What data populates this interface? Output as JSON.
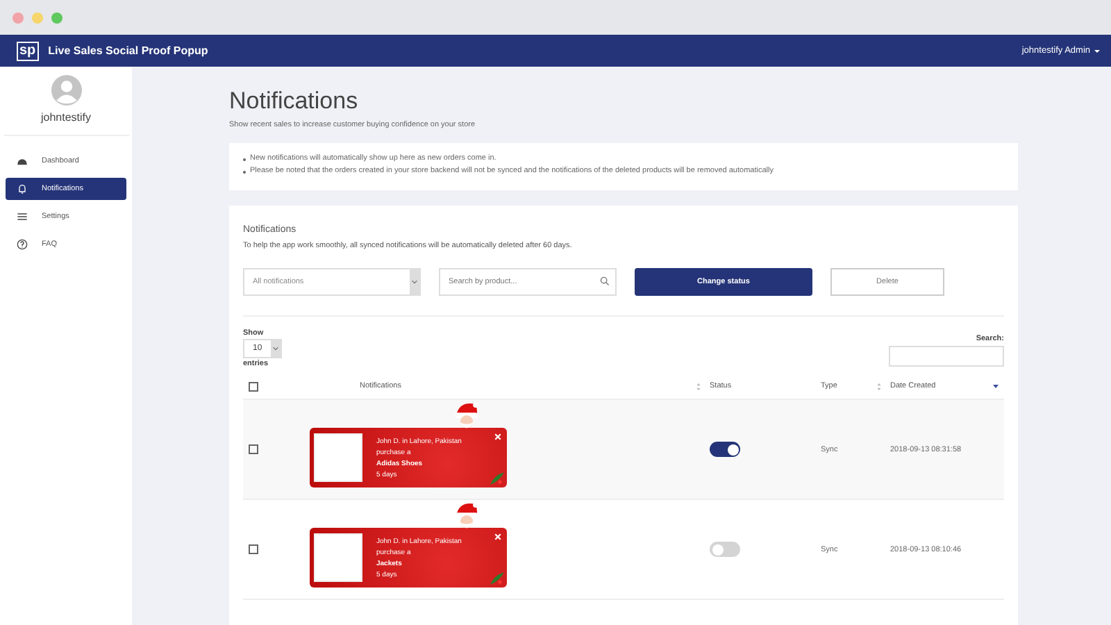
{
  "header": {
    "logo": "sp",
    "title": "Live Sales Social Proof Popup",
    "user_menu": "johntestify Admin"
  },
  "sidebar": {
    "username": "johntestify",
    "items": [
      {
        "label": "Dashboard",
        "selected": false
      },
      {
        "label": "Notifications",
        "selected": true
      },
      {
        "label": "Settings",
        "selected": false
      },
      {
        "label": "FAQ",
        "selected": false
      }
    ]
  },
  "page": {
    "title": "Notifications",
    "subtitle": "Show recent sales to increase customer buying confidence on your store",
    "notes": [
      "New notifications will automatically show up here as new orders come in.",
      "Please be noted that the orders created in your store backend will not be synced and the notifications of the deleted products will be removed automatically"
    ]
  },
  "card": {
    "title": "Notifications",
    "description": "To help the app work smoothly, all synced notifications will be automatically deleted after 60 days.",
    "filter": {
      "value": "All notifications"
    },
    "search": {
      "placeholder": "Search by product..."
    },
    "buttons": {
      "change_status": "Change status",
      "delete": "Delete"
    },
    "show_label": "Show",
    "page_length": "10",
    "entries_label": "entries",
    "search_label": "Search:",
    "select_all": {
      "checked": false
    },
    "columns": [
      "Notifications",
      "Status",
      "Type",
      "Date Created"
    ],
    "rows": [
      {
        "checked": false,
        "popup": {
          "line1": "John D. in Lahore, Pakistan",
          "line2": "purchase a",
          "product": "Adidas Shoes",
          "time": "5 days"
        },
        "on": true,
        "type": "Sync",
        "date": "2018-09-13 08:31:58"
      },
      {
        "checked": false,
        "popup": {
          "line1": "John D. in Lahore, Pakistan",
          "line2": "purchase a",
          "product": "Jackets",
          "time": "5 days"
        },
        "on": false,
        "type": "Sync",
        "date": "2018-09-13 08:10:46"
      }
    ]
  }
}
